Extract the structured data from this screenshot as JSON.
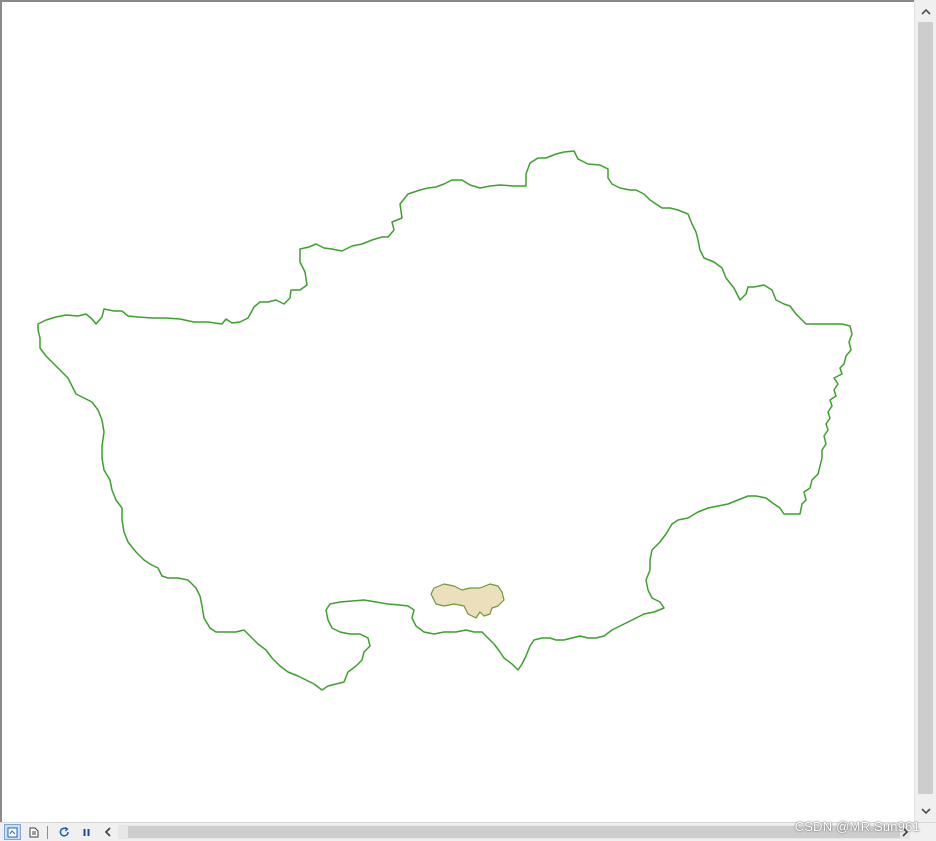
{
  "map": {
    "colors": {
      "boundary_stroke": "#3aa12a",
      "selection_fill": "#ecdfbc",
      "selection_stroke": "#6b9a3a",
      "background": "#ffffff"
    }
  },
  "vertical_scrollbar": {
    "up_icon": "chevron-up-icon",
    "down_icon": "chevron-down-icon"
  },
  "toolbar": {
    "data_view_icon": "data-view-icon",
    "layout_view_icon": "layout-view-icon",
    "refresh_icon": "refresh-icon",
    "pause_icon": "pause-icon",
    "scroll_left_icon": "chevron-left-icon",
    "scroll_right_icon": "chevron-right-icon"
  },
  "watermark": {
    "text": "CSDN @MR.Sun961"
  }
}
